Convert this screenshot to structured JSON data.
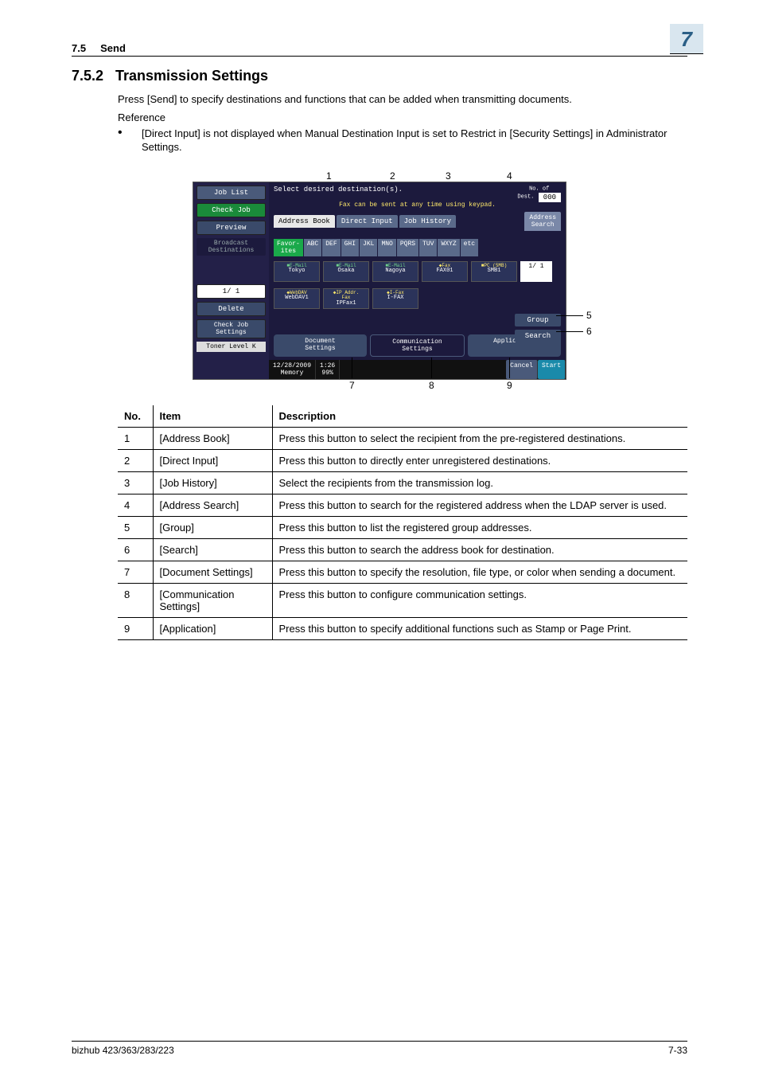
{
  "header": {
    "section": "7.5",
    "section_title": "Send",
    "chapter": "7"
  },
  "h2": {
    "num": "7.5.2",
    "title": "Transmission Settings"
  },
  "intro": "Press [Send] to specify destinations and functions that can be added when transmitting documents.",
  "reference_label": "Reference",
  "reference_bullet": "[Direct Input] is not displayed when Manual Destination Input is set to Restrict in [Security Settings] in Administrator Settings.",
  "callouts": {
    "top": [
      "1",
      "2",
      "3",
      "4"
    ],
    "right": [
      "5",
      "6"
    ],
    "bottom": [
      "7",
      "8",
      "9"
    ]
  },
  "screenshot": {
    "left_panel": {
      "job_list": "Job List",
      "check_job": "Check Job",
      "preview": "Preview",
      "broadcast": "Broadcast\nDestinations",
      "page": "1/  1",
      "delete": "Delete",
      "check_settings": "Check Job\nSettings",
      "toner": "Toner Level K"
    },
    "top_line": "Select desired destination(s).",
    "fax_line": "Fax can be sent at any time using keypad.",
    "dest_label": "No. of\nDest.",
    "dest_count": "000",
    "tabs": {
      "address_book": "Address Book",
      "direct_input": "Direct Input",
      "job_history": "Job History",
      "address_search": "Address\nSearch"
    },
    "index": [
      "Favor-\nites",
      "ABC",
      "DEF",
      "GHI",
      "JKL",
      "MNO",
      "PQRS",
      "TUV",
      "WXYZ",
      "etc"
    ],
    "destinations_row1": [
      {
        "type": "E-Mail",
        "name": "Tokyo"
      },
      {
        "type": "E-Mail",
        "name": "Osaka"
      },
      {
        "type": "E-Mail",
        "name": "Nagoya"
      },
      {
        "type": "Fax",
        "name": "FAX01"
      },
      {
        "type": "PC (SMB)",
        "name": "SMB1"
      }
    ],
    "destinations_row2": [
      {
        "type": "WebDAV",
        "name": "WebDAV1"
      },
      {
        "type": "IP Addr.\nFax",
        "name": "IPFax1"
      },
      {
        "type": "I-Fax",
        "name": "I-FAX"
      }
    ],
    "page_box": "1/  1",
    "group_btn": "Group",
    "search_btn": "Search",
    "bottom_tabs": {
      "doc": "Document\nSettings",
      "comm": "Communication\nSettings",
      "app": "Application"
    },
    "status": {
      "date": "12/28/2009",
      "memory": "Memory",
      "time": "1:26",
      "pct": "99%",
      "cancel": "Cancel",
      "start": "Start"
    }
  },
  "table": {
    "headers": [
      "No.",
      "Item",
      "Description"
    ],
    "rows": [
      {
        "no": "1",
        "item": "[Address Book]",
        "desc": "Press this button to select the recipient from the pre-registered destinations."
      },
      {
        "no": "2",
        "item": "[Direct Input]",
        "desc": "Press this button to directly enter unregistered destinations."
      },
      {
        "no": "3",
        "item": "[Job History]",
        "desc": "Select the recipients from the transmission log."
      },
      {
        "no": "4",
        "item": "[Address Search]",
        "desc": "Press this button to search for the registered address when the LDAP server is used."
      },
      {
        "no": "5",
        "item": "[Group]",
        "desc": "Press this button to list the registered group addresses."
      },
      {
        "no": "6",
        "item": "[Search]",
        "desc": "Press this button to search the address book for destination."
      },
      {
        "no": "7",
        "item": "[Document Settings]",
        "desc": "Press this button to specify the resolution, file type, or color when sending a document."
      },
      {
        "no": "8",
        "item": "[Communication Settings]",
        "desc": "Press this button to configure communication settings."
      },
      {
        "no": "9",
        "item": "[Application]",
        "desc": "Press this button to specify additional functions such as Stamp or Page Print."
      }
    ]
  },
  "footer": {
    "left": "bizhub 423/363/283/223",
    "right": "7-33"
  }
}
